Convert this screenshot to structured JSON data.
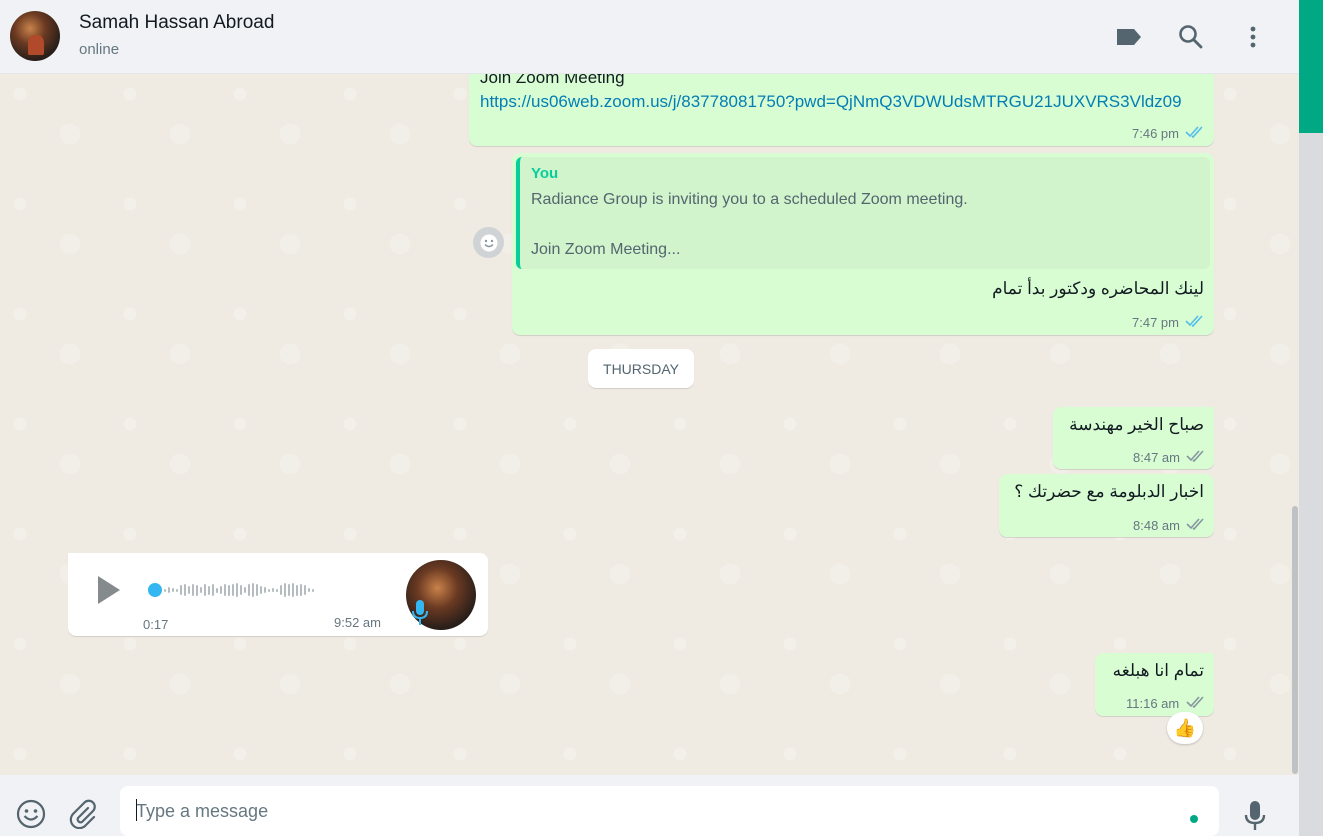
{
  "header": {
    "name": "Samah Hassan Abroad",
    "status": "online",
    "icons": [
      "label-icon",
      "search-icon",
      "menu-icon"
    ]
  },
  "messages": {
    "m1": {
      "line": "Join Zoom Meeting",
      "link": "https://us06web.zoom.us/j/83778081750?pwd=QjNmQ3VDWUdsMTRGU21JUXVRS3Vldz09",
      "time": "7:46 pm"
    },
    "m2": {
      "quote_author": "You",
      "quote_line1": "Radiance Group is inviting you to a scheduled Zoom meeting.",
      "quote_line2": "Join Zoom Meeting...",
      "text": "لينك المحاضره ودكتور بدأ تمام",
      "time": "7:47 pm"
    },
    "day_chip": "THURSDAY",
    "m3": {
      "text": "صباح الخير مهندسة",
      "time": "8:47 am"
    },
    "m4": {
      "text": "اخبار الدبلومة مع حضرتك ؟",
      "time": "8:48 am"
    },
    "voice": {
      "duration": "0:17",
      "time": "9:52 am"
    },
    "m5": {
      "text": "تمام انا هبلغه",
      "time": "11:16 am",
      "reaction": "👍"
    }
  },
  "footer": {
    "placeholder": "Type a message"
  },
  "colors": {
    "outgoing_bubble": "#d9fdd3",
    "incoming_bubble": "#ffffff",
    "accent": "#00a884",
    "link": "#027eb5",
    "tick_read": "#53bdeb"
  }
}
